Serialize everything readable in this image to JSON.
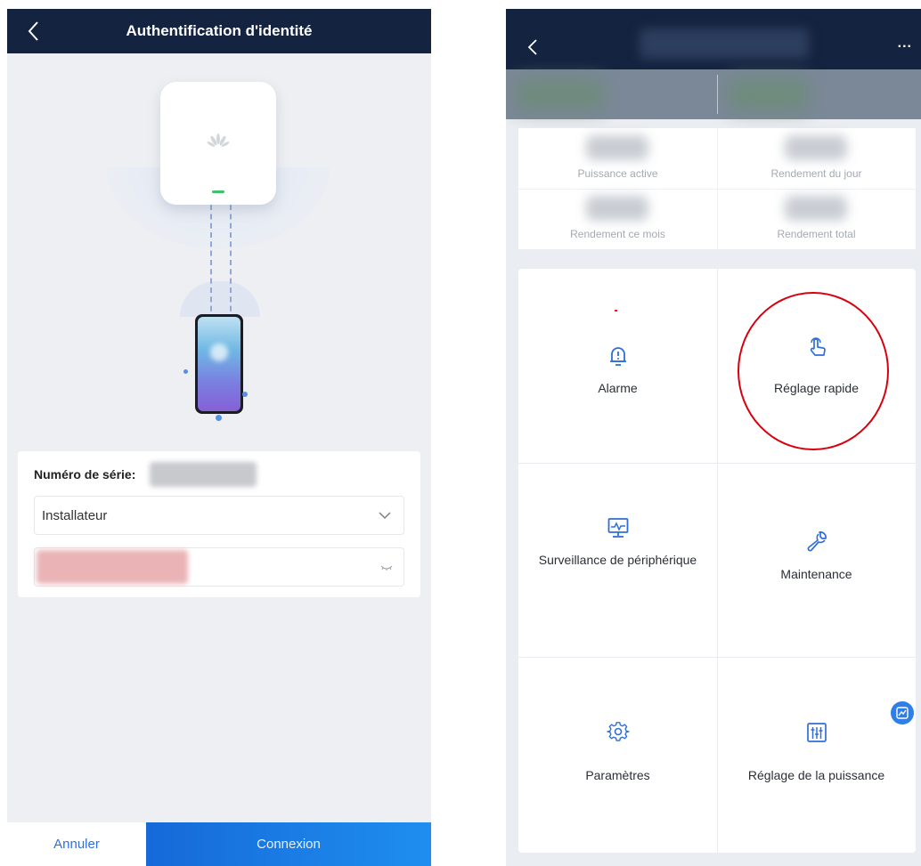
{
  "left": {
    "header": {
      "title": "Authentification d'identité"
    },
    "form": {
      "serial_label": "Numéro de série:",
      "role_value": "Installateur"
    },
    "actions": {
      "cancel_label": "Annuler",
      "connect_label": "Connexion"
    }
  },
  "right": {
    "header": {
      "more_label": "..."
    },
    "stats": [
      {
        "label": "Puissance active"
      },
      {
        "label": "Rendement du jour"
      },
      {
        "label": "Rendement ce mois"
      },
      {
        "label": "Rendement total"
      }
    ],
    "menu": [
      {
        "label": "Alarme",
        "icon": "bell-alert-icon"
      },
      {
        "label": "Réglage rapide",
        "icon": "touch-hand-icon"
      },
      {
        "label": "Surveillance de périphérique",
        "icon": "monitor-icon"
      },
      {
        "label": "Maintenance",
        "icon": "wrench-icon"
      },
      {
        "label": "Paramètres",
        "icon": "gear-icon"
      },
      {
        "label": "Réglage de la puissance",
        "icon": "sliders-icon"
      }
    ]
  },
  "colors": {
    "header_bg": "#14233f",
    "accent": "#2f6fd8",
    "highlight_circle": "#d9000e"
  }
}
